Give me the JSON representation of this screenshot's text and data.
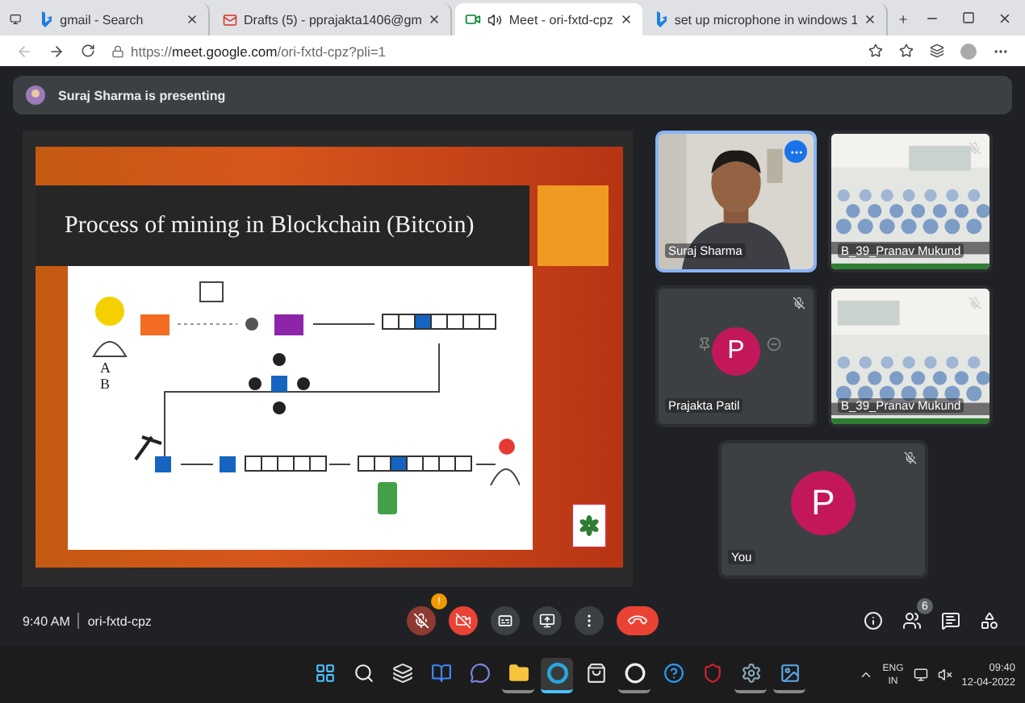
{
  "browser": {
    "tabs": [
      {
        "title": "gmail - Search",
        "kind": "bing",
        "selected": false,
        "playing_audio": false
      },
      {
        "title": "Drafts (5) - pprajakta1406@gm",
        "kind": "gmail",
        "selected": false,
        "playing_audio": false
      },
      {
        "title": "Meet - ori-fxtd-cpz",
        "kind": "meet",
        "selected": true,
        "playing_audio": true
      },
      {
        "title": "set up microphone in windows 1",
        "kind": "bing",
        "selected": false,
        "playing_audio": false
      }
    ],
    "address": "https://**meet.google.com**/ori-fxtd-cpz?pli=1"
  },
  "banner": {
    "text": "Suraj Sharma is presenting"
  },
  "slide": {
    "title": "Process of mining in Blockchain (Bitcoin)",
    "annotations": [
      "A",
      "B"
    ]
  },
  "tiles": [
    {
      "name": "Suraj Sharma",
      "kind": "camera",
      "speaking": true,
      "muted": false
    },
    {
      "name": "B_39_Pranav Mukund",
      "kind": "classroom",
      "speaking": false,
      "muted": true
    },
    {
      "name": "Prajakta Patil",
      "kind": "avatar",
      "initial": "P",
      "speaking": false,
      "muted": true
    },
    {
      "name": "B_39_Pranav Mukund",
      "kind": "classroom2",
      "speaking": false,
      "muted": true
    },
    {
      "name": "You",
      "kind": "avatar",
      "initial": "P",
      "speaking": false,
      "muted": true
    }
  ],
  "meeting": {
    "time": "9:40 AM",
    "code": "ori-fxtd-cpz"
  },
  "controls": [
    {
      "kind": "mic",
      "off": true,
      "badge": "!"
    },
    {
      "kind": "camera",
      "off": true
    },
    {
      "kind": "captions",
      "off": false
    },
    {
      "kind": "present",
      "off": false
    },
    {
      "kind": "more",
      "off": false
    },
    {
      "kind": "end"
    }
  ],
  "side_buttons": [
    {
      "kind": "info"
    },
    {
      "kind": "people",
      "badge": "6"
    },
    {
      "kind": "chat"
    },
    {
      "kind": "activities"
    }
  ],
  "taskbar": {
    "icons": [
      {
        "kind": "start",
        "active": false,
        "running": false
      },
      {
        "kind": "search",
        "active": false,
        "running": false
      },
      {
        "kind": "taskview",
        "active": false,
        "running": false
      },
      {
        "kind": "widgets",
        "active": false,
        "running": false
      },
      {
        "kind": "chat",
        "active": false,
        "running": false
      },
      {
        "kind": "explorer",
        "active": false,
        "running": true
      },
      {
        "kind": "edge",
        "active": true,
        "running": true
      },
      {
        "kind": "store",
        "active": false,
        "running": false
      },
      {
        "kind": "chrome",
        "active": false,
        "running": true
      },
      {
        "kind": "help",
        "active": false,
        "running": false
      },
      {
        "kind": "shield",
        "active": false,
        "running": false
      },
      {
        "kind": "settings",
        "active": false,
        "running": true
      },
      {
        "kind": "photos",
        "active": false,
        "running": true
      }
    ],
    "language": "ENG",
    "region": "IN",
    "time": "09:40",
    "date": "12-04-2022"
  }
}
